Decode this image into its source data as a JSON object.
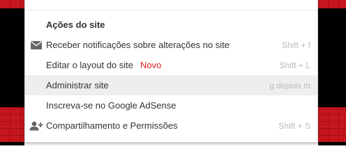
{
  "menu": {
    "heading": "Ações do site",
    "items": [
      {
        "label": "Receber notificações sobre alterações no site",
        "shortcut": "Shift + f",
        "icon": "envelope-icon"
      },
      {
        "label": "Editar o layout do site",
        "badge": "Novo",
        "shortcut": "Shift + L"
      },
      {
        "label": "Administrar site",
        "shortcut": "g depois m",
        "highlighted": true
      },
      {
        "label": "Inscreva-se no Google AdSense",
        "shortcut": ""
      },
      {
        "label": "Compartilhamento e Permissões",
        "shortcut": "Shift + S",
        "icon": "add-person-icon"
      }
    ]
  },
  "colors": {
    "badge": "#dd1d1d",
    "background_red": "#c5161d",
    "background_black": "#000000",
    "highlight": "#eeeeee"
  }
}
